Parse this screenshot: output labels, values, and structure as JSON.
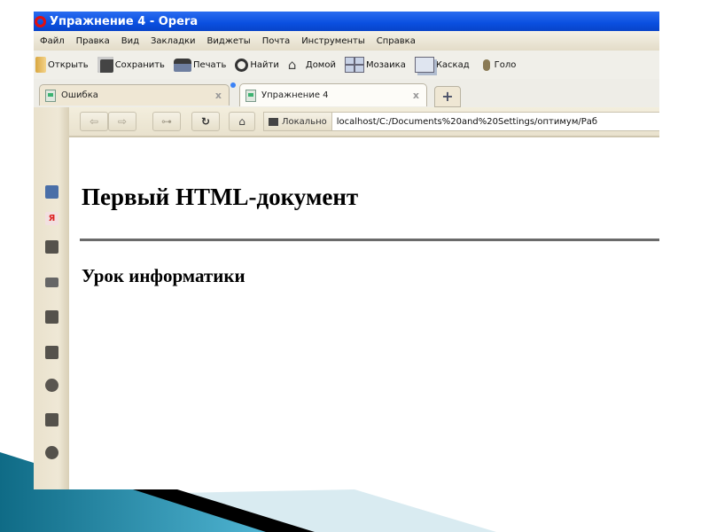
{
  "window": {
    "title": "Упражнение 4 - Opera"
  },
  "menu": [
    "Файл",
    "Правка",
    "Вид",
    "Закладки",
    "Виджеты",
    "Почта",
    "Инструменты",
    "Справка"
  ],
  "toolbar": [
    {
      "label": "Открыть",
      "icon": "open-folder-icon"
    },
    {
      "label": "Сохранить",
      "icon": "save-disk-icon"
    },
    {
      "label": "Печать",
      "icon": "printer-icon"
    },
    {
      "label": "Найти",
      "icon": "search-icon"
    },
    {
      "label": "Домой",
      "icon": "home-icon"
    },
    {
      "label": "Мозаика",
      "icon": "tile-icon"
    },
    {
      "label": "Каскад",
      "icon": "cascade-icon"
    },
    {
      "label": "Голо",
      "icon": "microphone-icon"
    }
  ],
  "tabs": [
    {
      "label": "Ошибка",
      "active": false
    },
    {
      "label": "Упражнение 4",
      "active": true
    }
  ],
  "new_tab_label": "+",
  "tab_close_label": "x",
  "nav": {
    "back": "⇦",
    "forward": "⇨",
    "key": "⊶",
    "reload": "↻",
    "home": "⌂",
    "security_label": "Локально",
    "url": "localhost/C:/Documents%20and%20Settings/оптимум/Раб"
  },
  "page": {
    "heading": "Первый HTML-документ",
    "paragraph": "Урок информатики"
  },
  "colors": {
    "titlebar": "#0a4fe0",
    "opera_red": "#e01010",
    "accent_teal": "#1e7f9e"
  }
}
